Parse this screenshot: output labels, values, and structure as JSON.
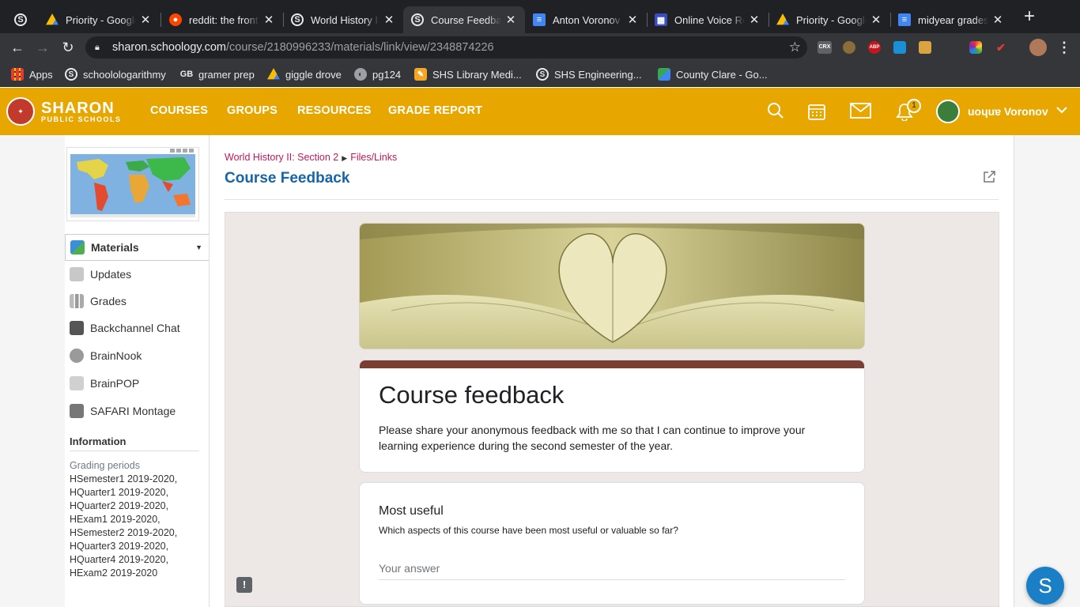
{
  "browser": {
    "tabs": [
      {
        "title": "",
        "icon": "schoology-icon"
      },
      {
        "title": "Priority - Google",
        "icon": "google-drive-icon"
      },
      {
        "title": "reddit: the front",
        "icon": "reddit-icon"
      },
      {
        "title": "World History II:",
        "icon": "schoology-icon"
      },
      {
        "title": "Course Feedback",
        "icon": "schoology-icon",
        "active": true
      },
      {
        "title": "Anton Voronov -",
        "icon": "google-docs-icon"
      },
      {
        "title": "Online Voice Re",
        "icon": "voice-recorder-icon"
      },
      {
        "title": "Priority - Google",
        "icon": "google-drive-icon"
      },
      {
        "title": "midyear grades",
        "icon": "google-docs-icon"
      }
    ],
    "url": {
      "host": "sharon.schoology.com",
      "path": "/course/2180996233/materials/link/view/2348874226"
    },
    "bookmarks": [
      {
        "label": "Apps",
        "icon": "apps-grid-icon"
      },
      {
        "label": "schoolologarithmy",
        "icon": "schoology-icon"
      },
      {
        "label": "gramer prep",
        "icon": "gb-icon"
      },
      {
        "label": "giggle drove",
        "icon": "google-drive-icon"
      },
      {
        "label": "pg124",
        "icon": "globe-icon"
      },
      {
        "label": "SHS Library Medi...",
        "icon": "library-icon"
      },
      {
        "label": "SHS Engineering...",
        "icon": "schoology-icon"
      },
      {
        "label": "County Clare - Go...",
        "icon": "maps-icon"
      }
    ],
    "extensions": [
      "CRX",
      "ABP"
    ]
  },
  "header": {
    "logo_line1": "SHARON",
    "logo_line2": "PUBLIC SCHOOLS",
    "nav": [
      "COURSES",
      "GROUPS",
      "RESOURCES",
      "GRADE REPORT"
    ],
    "notification_count": "1",
    "user_name": "uoɥuɐ Voronov"
  },
  "sidebar": {
    "items": [
      {
        "label": "Materials",
        "icon": "materials-icon"
      },
      {
        "label": "Updates",
        "icon": "updates-icon"
      },
      {
        "label": "Grades",
        "icon": "grades-icon"
      },
      {
        "label": "Backchannel Chat",
        "icon": "chat-icon"
      },
      {
        "label": "BrainNook",
        "icon": "brainnook-icon"
      },
      {
        "label": "BrainPOP",
        "icon": "brainpop-icon"
      },
      {
        "label": "SAFARI Montage",
        "icon": "safari-montage-icon"
      }
    ],
    "information_heading": "Information",
    "grading_periods_label": "Grading periods",
    "grading_periods": [
      "HSemester1 2019-2020,",
      "HQuarter1 2019-2020,",
      "HQuarter2 2019-2020,",
      "HExam1 2019-2020,",
      "HSemester2 2019-2020,",
      "HQuarter3 2019-2020,",
      "HQuarter4 2019-2020,",
      "HExam2 2019-2020"
    ]
  },
  "main": {
    "breadcrumb_course": "World History II: Section 2",
    "breadcrumb_section": "Files/Links",
    "page_title": "Course Feedback"
  },
  "form": {
    "title": "Course feedback",
    "description": "Please share your anonymous feedback with me so that I can continue to improve your learning experience during the second semester of the year.",
    "question_title": "Most useful",
    "question_description": "Which aspects of this course have been most useful or valuable so far?",
    "answer_placeholder": "Your answer",
    "accent_color": "#7a3e35"
  },
  "colors": {
    "schoology_header": "#e7a700",
    "link_title": "#1565a7",
    "breadcrumb": "#c2185b"
  },
  "fab_label": "S"
}
